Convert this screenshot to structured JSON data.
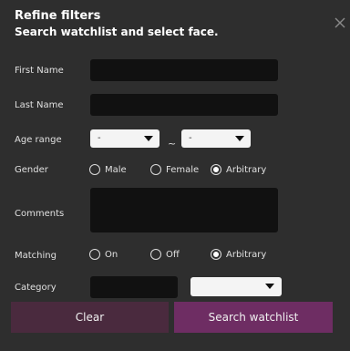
{
  "dialog": {
    "title": "Refine filters",
    "subtitle": "Search watchlist and select face.",
    "close_icon": "close-icon"
  },
  "form": {
    "first_name": {
      "label": "First Name",
      "value": ""
    },
    "last_name": {
      "label": "Last Name",
      "value": ""
    },
    "age_range": {
      "label": "Age range",
      "from": "-",
      "to": "-",
      "separator": "~"
    },
    "gender": {
      "label": "Gender",
      "options": [
        "Male",
        "Female",
        "Arbitrary"
      ],
      "selected": "Arbitrary"
    },
    "comments": {
      "label": "Comments",
      "value": ""
    },
    "matching": {
      "label": "Matching",
      "options": [
        "On",
        "Off",
        "Arbitrary"
      ],
      "selected": "Arbitrary"
    },
    "category": {
      "label": "Category",
      "value": "",
      "select_value": ""
    }
  },
  "buttons": {
    "clear": "Clear",
    "search": "Search watchlist"
  },
  "colors": {
    "background": "#2e2e2e",
    "input": "#111111",
    "clear_button": "#4a2a3e",
    "search_button": "#6e2d63"
  }
}
